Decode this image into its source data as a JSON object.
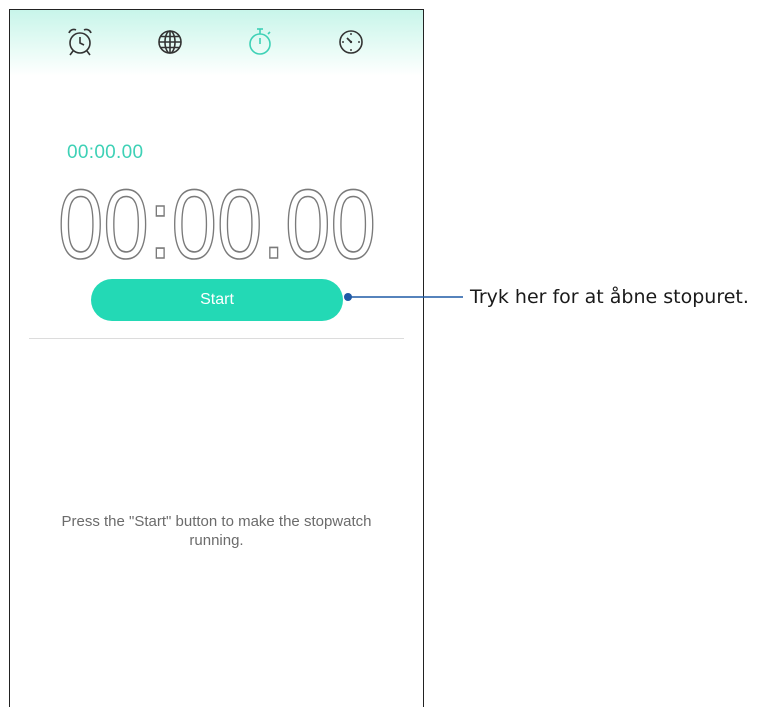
{
  "tabs": [
    {
      "icon": "alarm-clock-icon",
      "active": false
    },
    {
      "icon": "world-clock-globe-icon",
      "active": false
    },
    {
      "icon": "stopwatch-icon",
      "active": true
    },
    {
      "icon": "timer-icon",
      "active": false
    }
  ],
  "colors": {
    "accent": "#23d9b5",
    "accent_text": "#3ed1b6",
    "inactive_icon": "#333333",
    "time_digits": "#7a7a7a"
  },
  "stopwatch": {
    "lap_time": "00:00.00",
    "main_time": "00:00.00",
    "start_label": "Start",
    "hint": "Press the \"Start\" button to make the stopwatch running."
  },
  "annotation": {
    "callout": "Tryk her for at åbne stopuret."
  }
}
